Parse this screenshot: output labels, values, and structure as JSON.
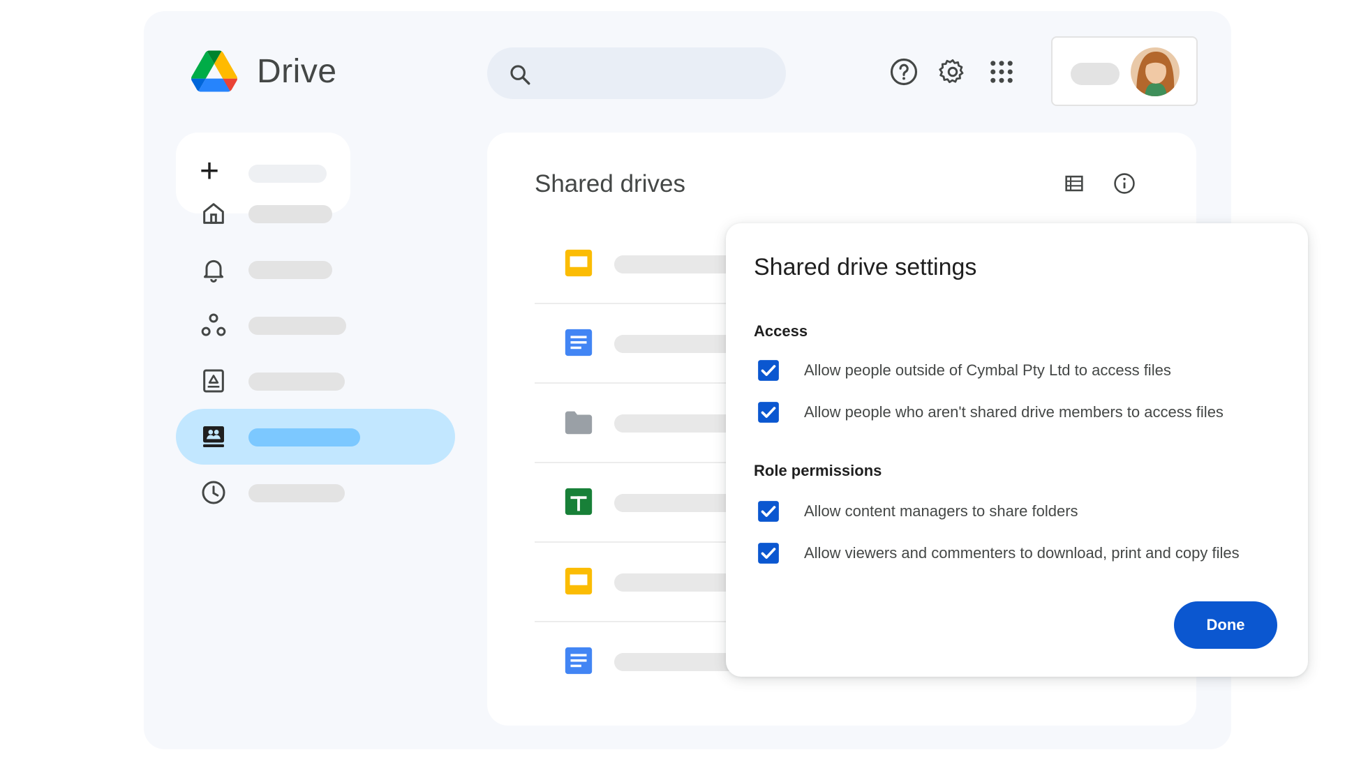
{
  "header": {
    "app_title": "Drive"
  },
  "main": {
    "heading": "Shared drives"
  },
  "dialog": {
    "title": "Shared drive settings",
    "sections": [
      {
        "label": "Access",
        "options": [
          {
            "label": "Allow people outside of Cymbal Pty Ltd to access files",
            "checked": true
          },
          {
            "label": "Allow people who aren't shared drive members to access files",
            "checked": true
          }
        ]
      },
      {
        "label": "Role permissions",
        "options": [
          {
            "label": "Allow content managers to share folders",
            "checked": true
          },
          {
            "label": "Allow viewers and commenters to download, print and copy files",
            "checked": true
          }
        ]
      }
    ],
    "done_label": "Done"
  },
  "colors": {
    "accent": "#0b57d0",
    "nav_active": "#c2e7ff",
    "checkbox": "#0b57d0"
  }
}
